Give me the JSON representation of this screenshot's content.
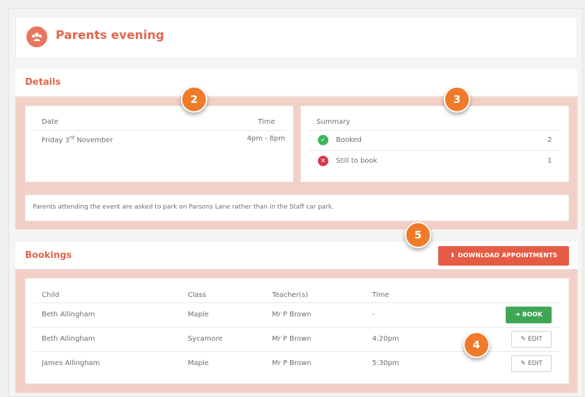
{
  "header": {
    "title": "Parents evening",
    "icon": "group-icon"
  },
  "details": {
    "title": "Details",
    "date_label": "Date",
    "time_label": "Time",
    "date_value": "Friday 3",
    "date_suffix": "rd",
    "date_month": " November",
    "time_value": "4pm - 8pm",
    "summary_title": "Summary",
    "summary": [
      {
        "label": "Booked",
        "count": "2",
        "icon": "check-icon"
      },
      {
        "label": "Still to book",
        "count": "1",
        "icon": "cross-icon"
      }
    ],
    "notice": "Parents attending the event are asked to park on Parsons Lane rather than in the Staff car park."
  },
  "bookings": {
    "title": "Bookings",
    "download_label": "DOWNLOAD APPOINTMENTS",
    "columns": [
      "Child",
      "Class",
      "Teacher(s)",
      "Time"
    ],
    "rows": [
      {
        "child": "Beth Allingham",
        "class": "Maple",
        "teacher": "Mr P Brown",
        "time": "-",
        "action": "BOOK"
      },
      {
        "child": "Beth Allingham",
        "class": "Sycamore",
        "teacher": "Mr P Brown",
        "time": "4:20pm",
        "action": "EDIT"
      },
      {
        "child": "James Allingham",
        "class": "Maple",
        "teacher": "Mr P Brown",
        "time": "5:30pm",
        "action": "EDIT"
      }
    ]
  },
  "callouts": [
    "2",
    "3",
    "5",
    "4"
  ],
  "colors": {
    "accent": "#e2664b",
    "pink": "#f2d0c8",
    "book": "#3fa653",
    "callout": "#ef7b2a"
  }
}
